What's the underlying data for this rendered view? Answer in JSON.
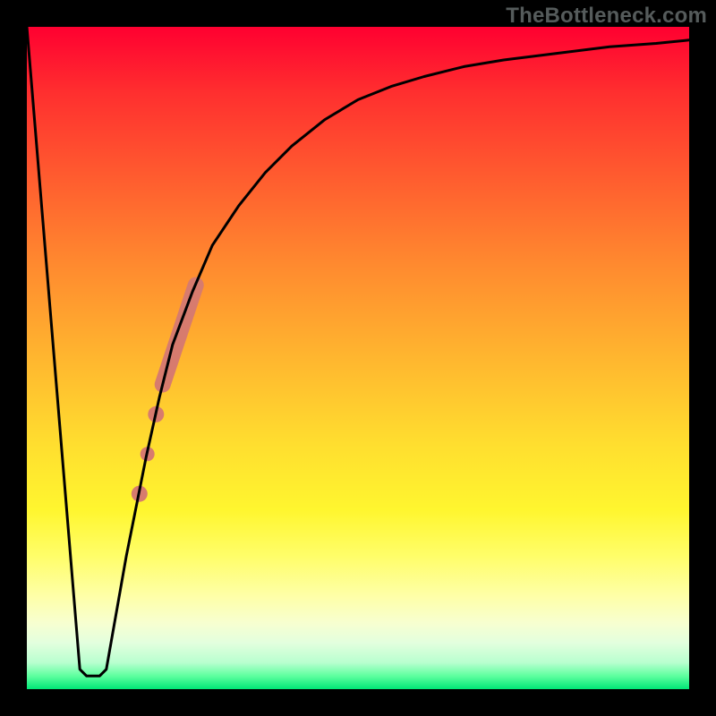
{
  "watermark": "TheBottleneck.com",
  "chart_data": {
    "type": "line",
    "title": "",
    "xlabel": "",
    "ylabel": "",
    "xlim": [
      0,
      100
    ],
    "ylim": [
      0,
      100
    ],
    "grid": false,
    "legend": false,
    "series": [
      {
        "name": "bottleneck-curve",
        "x": [
          0,
          8,
          9,
          11,
          12,
          15,
          18,
          20,
          22,
          25,
          28,
          32,
          36,
          40,
          45,
          50,
          55,
          60,
          66,
          72,
          80,
          88,
          95,
          100
        ],
        "y": [
          100,
          3,
          2,
          2,
          3,
          20,
          35,
          44,
          52,
          60,
          67,
          73,
          78,
          82,
          86,
          89,
          91,
          92.5,
          94,
          95,
          96,
          97,
          97.5,
          98
        ],
        "color": "#000000",
        "width": 3
      }
    ],
    "markers": [
      {
        "name": "thick-salmon-segment",
        "shape": "line",
        "x0": 20.5,
        "y0": 46,
        "x1": 25.5,
        "y1": 61,
        "color": "#d77b6e",
        "width": 18
      },
      {
        "name": "salmon-dot-1",
        "shape": "circle",
        "x": 19.5,
        "y": 41.5,
        "r": 9,
        "color": "#d77b6e"
      },
      {
        "name": "salmon-dot-2",
        "shape": "circle",
        "x": 18.2,
        "y": 35.5,
        "r": 8,
        "color": "#d77b6e"
      },
      {
        "name": "salmon-dot-3",
        "shape": "circle",
        "x": 17.0,
        "y": 29.5,
        "r": 9,
        "color": "#d77b6e"
      }
    ]
  }
}
